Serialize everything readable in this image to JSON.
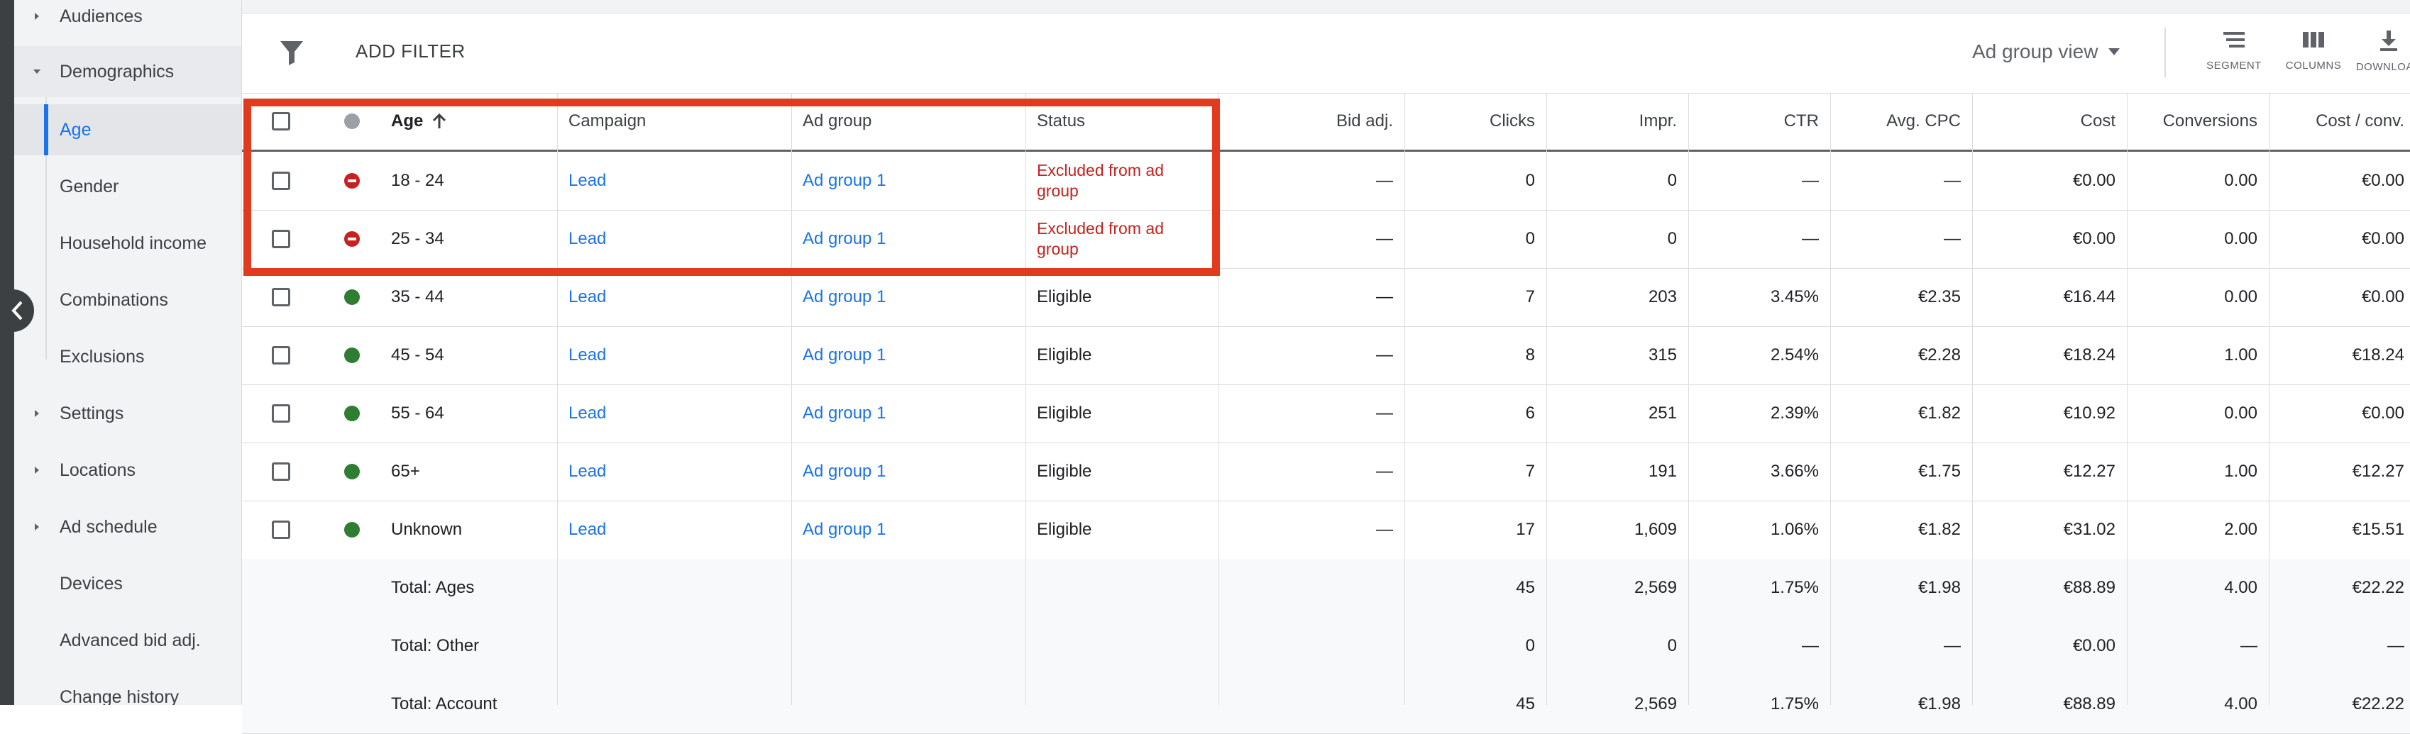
{
  "sidebar": {
    "items": [
      {
        "label": "Audiences",
        "type": "group",
        "state": "collapsed"
      },
      {
        "label": "Demographics",
        "type": "group",
        "state": "expanded"
      },
      {
        "label": "Age",
        "type": "sub",
        "active": true
      },
      {
        "label": "Gender",
        "type": "sub"
      },
      {
        "label": "Household income",
        "type": "sub"
      },
      {
        "label": "Combinations",
        "type": "sub"
      },
      {
        "label": "Exclusions",
        "type": "sub"
      },
      {
        "label": "Settings",
        "type": "group",
        "state": "collapsed"
      },
      {
        "label": "Locations",
        "type": "group",
        "state": "collapsed"
      },
      {
        "label": "Ad schedule",
        "type": "group",
        "state": "collapsed"
      },
      {
        "label": "Devices",
        "type": "item"
      },
      {
        "label": "Advanced bid adj.",
        "type": "item"
      },
      {
        "label": "Change history",
        "type": "item"
      }
    ]
  },
  "toolbar": {
    "add_filter": "ADD FILTER",
    "view_select": "Ad group view",
    "segment": "SEGMENT",
    "columns": "COLUMNS",
    "download": "DOWNLOAD"
  },
  "table": {
    "headers": {
      "age": "Age",
      "campaign": "Campaign",
      "ad_group": "Ad group",
      "status": "Status",
      "bid_adj": "Bid adj.",
      "clicks": "Clicks",
      "impr": "Impr.",
      "ctr": "CTR",
      "avg_cpc": "Avg. CPC",
      "cost": "Cost",
      "conversions": "Conversions",
      "cost_conv": "Cost / conv."
    },
    "rows": [
      {
        "age": "18 - 24",
        "campaign": "Lead",
        "ad_group": "Ad group 1",
        "status": "Excluded from ad group",
        "status_kind": "excluded",
        "bid_adj": "—",
        "clicks": "0",
        "impr": "0",
        "ctr": "—",
        "avg_cpc": "—",
        "cost": "€0.00",
        "conversions": "0.00",
        "cost_conv": "€0.00"
      },
      {
        "age": "25 - 34",
        "campaign": "Lead",
        "ad_group": "Ad group 1",
        "status": "Excluded from ad group",
        "status_kind": "excluded",
        "bid_adj": "—",
        "clicks": "0",
        "impr": "0",
        "ctr": "—",
        "avg_cpc": "—",
        "cost": "€0.00",
        "conversions": "0.00",
        "cost_conv": "€0.00"
      },
      {
        "age": "35 - 44",
        "campaign": "Lead",
        "ad_group": "Ad group 1",
        "status": "Eligible",
        "status_kind": "eligible",
        "bid_adj": "—",
        "clicks": "7",
        "impr": "203",
        "ctr": "3.45%",
        "avg_cpc": "€2.35",
        "cost": "€16.44",
        "conversions": "0.00",
        "cost_conv": "€0.00"
      },
      {
        "age": "45 - 54",
        "campaign": "Lead",
        "ad_group": "Ad group 1",
        "status": "Eligible",
        "status_kind": "eligible",
        "bid_adj": "—",
        "clicks": "8",
        "impr": "315",
        "ctr": "2.54%",
        "avg_cpc": "€2.28",
        "cost": "€18.24",
        "conversions": "1.00",
        "cost_conv": "€18.24"
      },
      {
        "age": "55 - 64",
        "campaign": "Lead",
        "ad_group": "Ad group 1",
        "status": "Eligible",
        "status_kind": "eligible",
        "bid_adj": "—",
        "clicks": "6",
        "impr": "251",
        "ctr": "2.39%",
        "avg_cpc": "€1.82",
        "cost": "€10.92",
        "conversions": "0.00",
        "cost_conv": "€0.00"
      },
      {
        "age": "65+",
        "campaign": "Lead",
        "ad_group": "Ad group 1",
        "status": "Eligible",
        "status_kind": "eligible",
        "bid_adj": "—",
        "clicks": "7",
        "impr": "191",
        "ctr": "3.66%",
        "avg_cpc": "€1.75",
        "cost": "€12.27",
        "conversions": "1.00",
        "cost_conv": "€12.27"
      },
      {
        "age": "Unknown",
        "campaign": "Lead",
        "ad_group": "Ad group 1",
        "status": "Eligible",
        "status_kind": "eligible",
        "bid_adj": "—",
        "clicks": "17",
        "impr": "1,609",
        "ctr": "1.06%",
        "avg_cpc": "€1.82",
        "cost": "€31.02",
        "conversions": "2.00",
        "cost_conv": "€15.51"
      }
    ],
    "totals": [
      {
        "label": "Total: Ages",
        "clicks": "45",
        "impr": "2,569",
        "ctr": "1.75%",
        "avg_cpc": "€1.98",
        "cost": "€88.89",
        "conversions": "4.00",
        "cost_conv": "€22.22"
      },
      {
        "label": "Total: Other",
        "clicks": "0",
        "impr": "0",
        "ctr": "—",
        "avg_cpc": "—",
        "cost": "€0.00",
        "conversions": "—",
        "cost_conv": "—"
      },
      {
        "label": "Total: Account",
        "clicks": "45",
        "impr": "2,569",
        "ctr": "1.75%",
        "avg_cpc": "€1.98",
        "cost": "€88.89",
        "conversions": "4.00",
        "cost_conv": "€22.22"
      }
    ]
  },
  "colors": {
    "accent": "#1a73e8",
    "excluded": "#c5221f",
    "eligible_dot": "#2e7d32",
    "highlight_box": "#e23a1e"
  },
  "icons": {
    "filter": "filter-icon",
    "dropdown": "caret-down-icon",
    "segment": "segment-icon",
    "columns": "columns-icon",
    "download": "download-icon",
    "sort": "arrow-up-icon",
    "collapse": "chevron-left-icon"
  }
}
